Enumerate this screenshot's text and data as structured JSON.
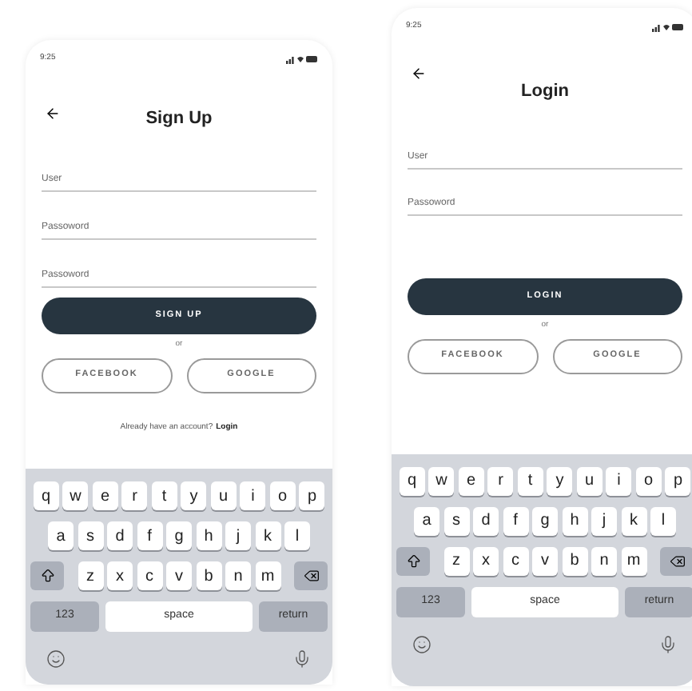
{
  "screens": [
    {
      "status_time": "9:25",
      "title": "Sign Up",
      "fields": [
        {
          "placeholder": "User"
        },
        {
          "placeholder": "Passoword"
        },
        {
          "placeholder": "Passoword"
        }
      ],
      "primary_button": "SIGN UP",
      "divider_text": "or",
      "social_buttons": [
        "FACEBOOK",
        "GOOGLE"
      ],
      "footer": {
        "text": "Already have an account?",
        "link": "Login"
      },
      "keyboard": {
        "rows": [
          [
            "q",
            "w",
            "e",
            "r",
            "t",
            "y",
            "u",
            "i",
            "o",
            "p"
          ],
          [
            "a",
            "s",
            "d",
            "f",
            "g",
            "h",
            "j",
            "k",
            "l"
          ],
          [
            "z",
            "x",
            "c",
            "v",
            "b",
            "n",
            "m"
          ]
        ],
        "numbers_key": "123",
        "space_key": "space",
        "return_key": "return"
      }
    },
    {
      "status_time": "9:25",
      "title": "Login",
      "fields": [
        {
          "placeholder": "User"
        },
        {
          "placeholder": "Passoword"
        }
      ],
      "primary_button": "LOGIN",
      "divider_text": "or",
      "social_buttons": [
        "FACEBOOK",
        "GOOGLE"
      ],
      "keyboard": {
        "rows": [
          [
            "q",
            "w",
            "e",
            "r",
            "t",
            "y",
            "u",
            "i",
            "o",
            "p"
          ],
          [
            "a",
            "s",
            "d",
            "f",
            "g",
            "h",
            "j",
            "k",
            "l"
          ],
          [
            "z",
            "x",
            "c",
            "v",
            "b",
            "n",
            "m"
          ]
        ],
        "numbers_key": "123",
        "space_key": "space",
        "return_key": "return"
      }
    }
  ]
}
